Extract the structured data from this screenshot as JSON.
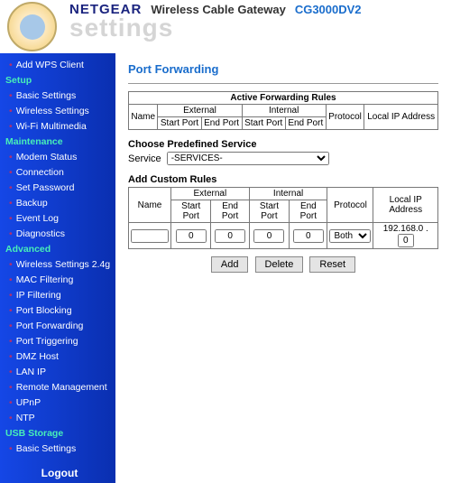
{
  "header": {
    "brand": "NETGEAR",
    "product": "Wireless Cable Gateway",
    "model": "CG3000DV2",
    "settings_word": "settings"
  },
  "sidebar": {
    "top_item": "Add WPS Client",
    "sections": [
      {
        "title": "Setup",
        "items": [
          "Basic Settings",
          "Wireless Settings",
          "Wi-Fi Multimedia"
        ]
      },
      {
        "title": "Maintenance",
        "items": [
          "Modem Status",
          "Connection",
          "Set Password",
          "Backup",
          "Event Log",
          "Diagnostics"
        ]
      },
      {
        "title": "Advanced",
        "items": [
          "Wireless Settings 2.4g",
          "MAC Filtering",
          "IP Filtering",
          "Port Blocking",
          "Port Forwarding",
          "Port Triggering",
          "DMZ Host",
          "LAN IP",
          "Remote Management",
          "UPnP",
          "NTP"
        ]
      },
      {
        "title": "USB Storage",
        "items": [
          "Basic Settings"
        ]
      }
    ],
    "logout": "Logout"
  },
  "page": {
    "title": "Port Forwarding",
    "active_rules": {
      "title": "Active Forwarding Rules",
      "external": "External",
      "internal": "Internal",
      "cols": [
        "Name",
        "Start Port",
        "End Port",
        "Start Port",
        "End Port",
        "Protocol",
        "Local IP Address"
      ]
    },
    "predef": {
      "title": "Choose Predefined Service",
      "label": "Service",
      "selected": "-SERVICES-"
    },
    "custom": {
      "title": "Add Custom Rules",
      "external": "External",
      "internal": "Internal",
      "cols": [
        "Name",
        "Start Port",
        "End Port",
        "Start Port",
        "End Port",
        "Protocol",
        "Local IP Address"
      ],
      "row": {
        "name": "",
        "ext_start": "0",
        "ext_end": "0",
        "int_start": "0",
        "int_end": "0",
        "protocol": "Both",
        "ip_prefix": "192.168.0 .",
        "ip_last": "0"
      }
    },
    "buttons": {
      "add": "Add",
      "delete": "Delete",
      "reset": "Reset"
    }
  }
}
